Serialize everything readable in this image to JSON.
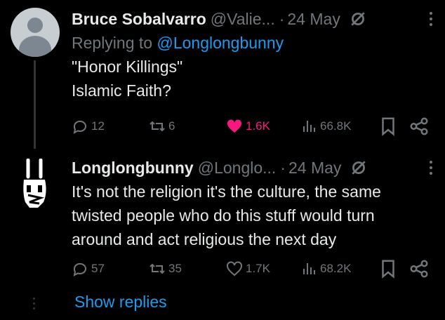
{
  "tweets": [
    {
      "name": "Bruce Sobalvarro",
      "handle": "@Valie...",
      "separator": "·",
      "date": "24 May",
      "replying_prefix": "Replying to",
      "replying_handle": "@Longlongbunny",
      "lines": [
        "\"Honor Killings\"",
        "Islamic Faith?"
      ],
      "replies": "12",
      "reposts": "6",
      "likes": "1.6K",
      "liked": true,
      "views": "66.8K"
    },
    {
      "name": "Longlongbunny",
      "handle": "@Longlo...",
      "separator": "·",
      "date": "24 May",
      "lines": [
        "It's not the religion it's the culture, the same",
        "twisted people who do this stuff would turn",
        "around and act religious the next day"
      ],
      "replies": "57",
      "reposts": "35",
      "likes": "1.7K",
      "liked": false,
      "views": "68.2K"
    }
  ],
  "show_replies": "Show replies",
  "colors": {
    "background": "#000000",
    "text": "#e7e9ea",
    "muted": "#71767b",
    "link": "#1d9bf0",
    "like": "#f91880"
  }
}
